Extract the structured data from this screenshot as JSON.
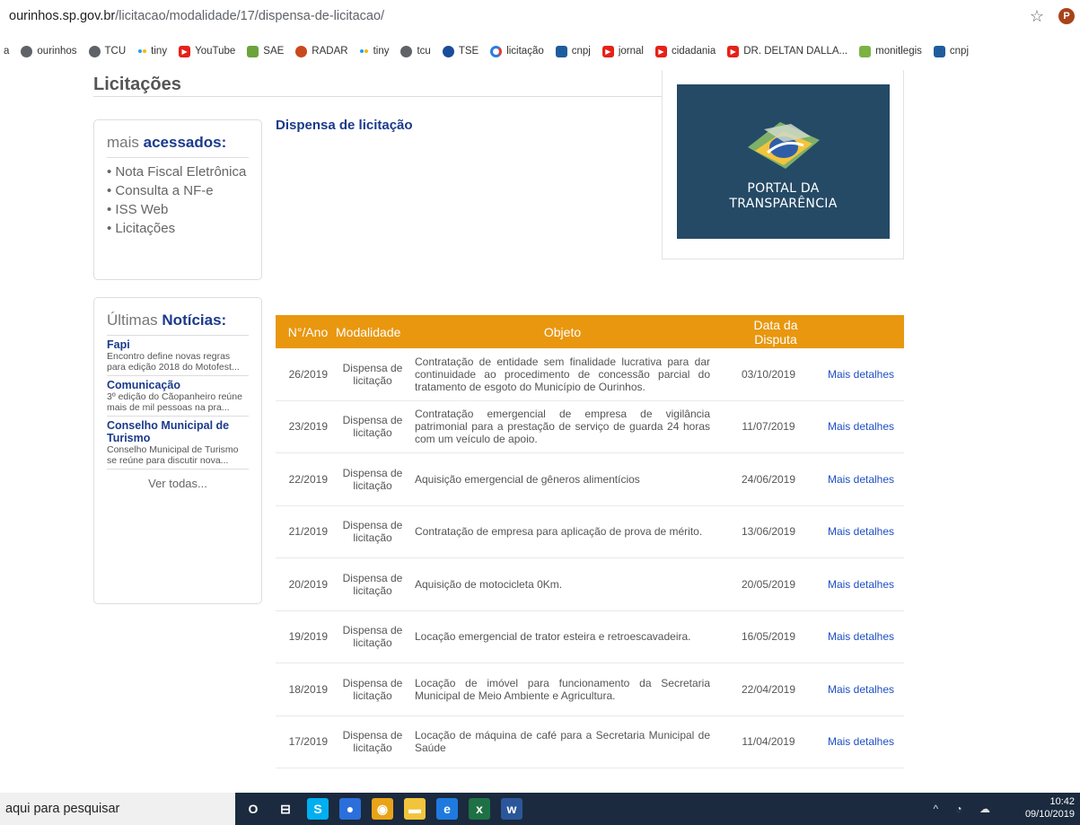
{
  "address_bar": {
    "host": "ourinhos.sp.gov.br",
    "path": "/licitacao/modalidade/17/dispensa-de-licitacao/",
    "profile_initial": "P"
  },
  "bookmarks": [
    {
      "label": "a",
      "icon": "none"
    },
    {
      "label": "ourinhos",
      "icon": "globe"
    },
    {
      "label": "TCU",
      "icon": "globe"
    },
    {
      "label": "tiny",
      "icon": "dots"
    },
    {
      "label": "YouTube",
      "icon": "yt"
    },
    {
      "label": "SAE",
      "icon": "sae"
    },
    {
      "label": "RADAR",
      "icon": "radar"
    },
    {
      "label": "tiny",
      "icon": "dots"
    },
    {
      "label": "tcu",
      "icon": "globe"
    },
    {
      "label": "TSE",
      "icon": "tse"
    },
    {
      "label": "licitação",
      "icon": "lic"
    },
    {
      "label": "cnpj",
      "icon": "cnpj"
    },
    {
      "label": "jornal",
      "icon": "yt"
    },
    {
      "label": "cidadania",
      "icon": "yt"
    },
    {
      "label": "DR. DELTAN DALLA...",
      "icon": "yt"
    },
    {
      "label": "monitlegis",
      "icon": "mon"
    },
    {
      "label": "cnpj",
      "icon": "cnpj"
    }
  ],
  "page": {
    "title": "Licitações",
    "subtitle": "Dispensa de licitação"
  },
  "mais_acessados": {
    "heading_light": "mais ",
    "heading_bold": "acessados:",
    "items": [
      "• Nota Fiscal Eletrônica",
      "• Consulta a NF-e",
      "• ISS Web",
      "• Licitações"
    ]
  },
  "noticias": {
    "heading_light": "Últimas ",
    "heading_bold": "Notícias:",
    "items": [
      {
        "title": "Fapi",
        "desc": "Encontro define novas regras para edição 2018 do Motofest..."
      },
      {
        "title": "Comunicação",
        "desc": "3º edição do Cãopanheiro reúne mais de mil pessoas na pra..."
      },
      {
        "title": "Conselho Municipal de Turismo",
        "desc": "Conselho Municipal de Turismo se reúne para discutir nova..."
      }
    ],
    "ver_todas": "Ver todas..."
  },
  "portal": {
    "line1": "PORTAL DA",
    "line2": "TRANSPARÊNCIA"
  },
  "table": {
    "headers": [
      "N°/Ano",
      "Modalidade",
      "Objeto",
      "Data da Disputa",
      ""
    ],
    "rows": [
      {
        "num": "26/2019",
        "mod": "Dispensa de licitação",
        "obj": "Contratação de entidade sem finalidade lucrativa para dar continuidade ao procedimento de concessão parcial do tratamento de esgoto do Município de Ourinhos.",
        "data": "03/10/2019",
        "link": "Mais detalhes"
      },
      {
        "num": "23/2019",
        "mod": "Dispensa de licitação",
        "obj": "Contratação emergencial de empresa de vigilância patrimonial para a prestação de serviço de guarda 24 horas com um veículo de apoio.",
        "data": "11/07/2019",
        "link": "Mais detalhes"
      },
      {
        "num": "22/2019",
        "mod": "Dispensa de licitação",
        "obj": "Aquisição emergencial de gêneros alimentícios",
        "data": "24/06/2019",
        "link": "Mais detalhes"
      },
      {
        "num": "21/2019",
        "mod": "Dispensa de licitação",
        "obj": "Contratação de empresa para aplicação de prova de mérito.",
        "data": "13/06/2019",
        "link": "Mais detalhes"
      },
      {
        "num": "20/2019",
        "mod": "Dispensa de licitação",
        "obj": "Aquisição de motocicleta 0Km.",
        "data": "20/05/2019",
        "link": "Mais detalhes"
      },
      {
        "num": "19/2019",
        "mod": "Dispensa de licitação",
        "obj": "Locação emergencial de trator esteira e retroescavadeira.",
        "data": "16/05/2019",
        "link": "Mais detalhes"
      },
      {
        "num": "18/2019",
        "mod": "Dispensa de licitação",
        "obj": "Locação de imóvel para funcionamento da Secretaria Municipal de Meio Ambiente e Agricultura.",
        "data": "22/04/2019",
        "link": "Mais detalhes"
      },
      {
        "num": "17/2019",
        "mod": "Dispensa de licitação",
        "obj": "Locação de máquina de café para a Secretaria Municipal de Saúde",
        "data": "11/04/2019",
        "link": "Mais detalhes"
      }
    ]
  },
  "taskbar": {
    "search_text": "aqui para pesquisar",
    "time": "10:42",
    "date": "09/10/2019",
    "apps": [
      {
        "name": "cortana",
        "glyph": "O",
        "color": "transparent"
      },
      {
        "name": "task-view",
        "glyph": "⊟",
        "color": "transparent"
      },
      {
        "name": "skype",
        "glyph": "S",
        "color": "#00aff0"
      },
      {
        "name": "app",
        "glyph": "●",
        "color": "#2a6fdb"
      },
      {
        "name": "chrome",
        "glyph": "◉",
        "color": "#e8a317"
      },
      {
        "name": "explorer",
        "glyph": "▬",
        "color": "#f2c43c"
      },
      {
        "name": "edge",
        "glyph": "e",
        "color": "#1f7ae0"
      },
      {
        "name": "excel",
        "glyph": "x",
        "color": "#1e7145"
      },
      {
        "name": "word",
        "glyph": "w",
        "color": "#2b579a"
      }
    ]
  }
}
